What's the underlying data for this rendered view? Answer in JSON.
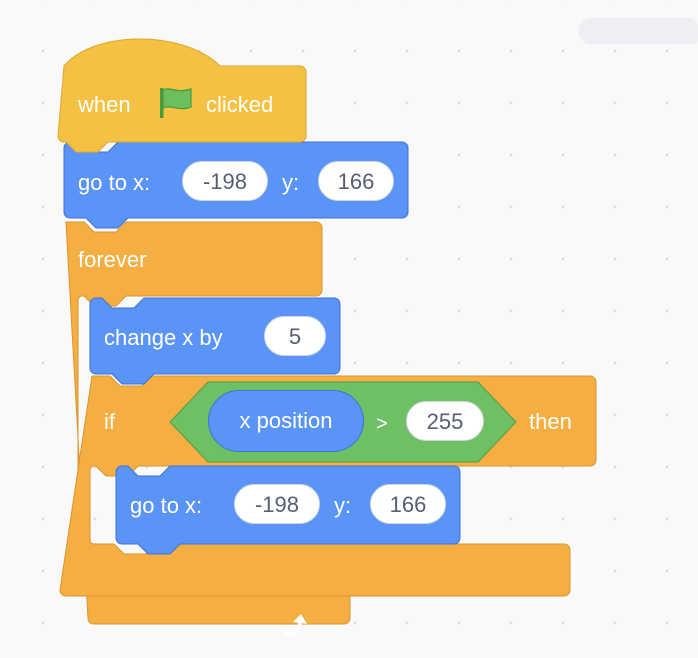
{
  "workspace": {
    "type": "scratch-code-area"
  },
  "script": {
    "hat": {
      "before": "when",
      "icon": "green-flag",
      "after": "clicked"
    },
    "goto1": {
      "label": "go to x:",
      "x": "-198",
      "ylabel": "y:",
      "y": "166"
    },
    "forever": {
      "label": "forever",
      "icon": "loop-arrow"
    },
    "change": {
      "label": "change x by",
      "value": "5"
    },
    "if": {
      "label": "if",
      "then": "then",
      "condition": {
        "reporter": "x position",
        "op": ">",
        "value": "255"
      }
    },
    "goto2": {
      "label": "go to x:",
      "x": "-198",
      "ylabel": "y:",
      "y": "166"
    }
  },
  "colors": {
    "events": "#ffbf00",
    "motion": "#4c97ff",
    "control": "#ffab19",
    "operators": "#59c059"
  }
}
